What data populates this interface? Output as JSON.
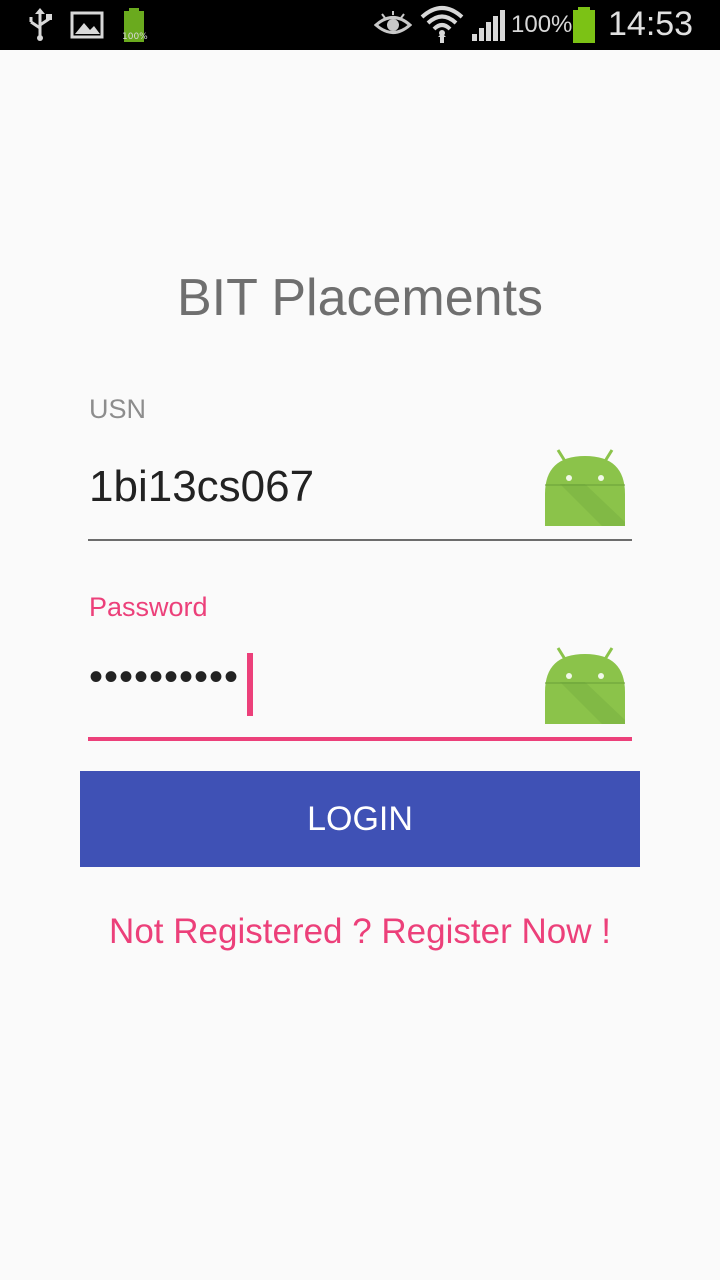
{
  "status_bar": {
    "battery_small_label": "100%",
    "battery_percent": "100%",
    "time": "14:53",
    "icons": [
      "usb-icon",
      "gallery-icon",
      "battery-icon",
      "eye-icon",
      "wifi-icon",
      "signal-icon",
      "battery-icon"
    ]
  },
  "app": {
    "title": "BIT Placements"
  },
  "form": {
    "usn": {
      "label": "USN",
      "value": "1bi13cs067"
    },
    "password": {
      "label": "Password",
      "value": "••••••••••"
    },
    "login_label": "LOGIN",
    "register_text": "Not Registered ? Register Now !"
  },
  "colors": {
    "accent": "#ec407a",
    "primary": "#3f51b5",
    "android_green": "#8bc34a"
  }
}
